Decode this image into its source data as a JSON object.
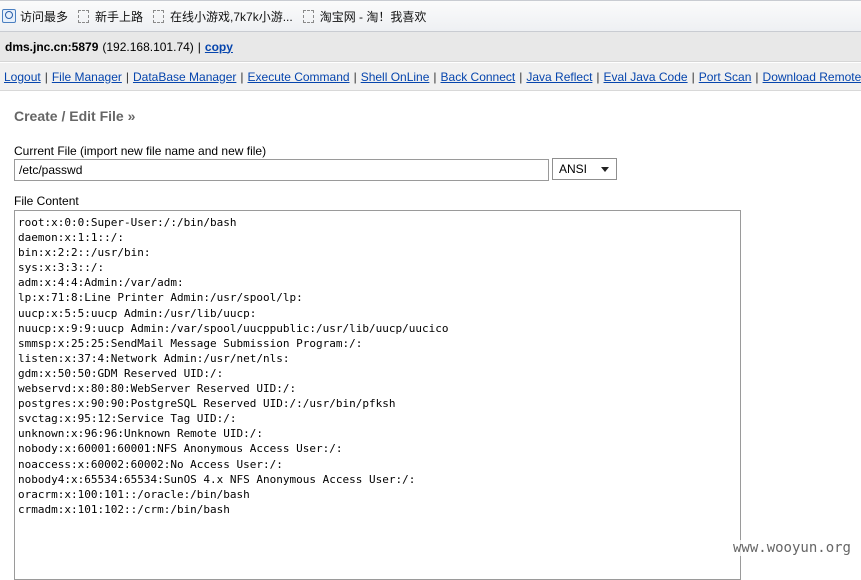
{
  "bookmarks": [
    {
      "icon": "search-icon",
      "label": "访问最多"
    },
    {
      "icon": "page-icon",
      "label": "新手上路"
    },
    {
      "icon": "page-icon",
      "label": "在线小游戏,7k7k小游..."
    },
    {
      "icon": "page-icon",
      "label": "淘宝网 - 淘！我喜欢"
    }
  ],
  "host": {
    "name": "dms.jnc.cn:5879",
    "ip": "(192.168.101.74)",
    "separator": "|",
    "copy_label": "copy"
  },
  "nav": [
    "Logout",
    "File Manager",
    "DataBase Manager",
    "Execute Command",
    "Shell OnLine",
    "Back Connect",
    "Java Reflect",
    "Eval Java Code",
    "Port Scan",
    "Download Remote"
  ],
  "form": {
    "title": "Create / Edit File »",
    "current_file_label": "Current File (import new file name and new file)",
    "current_file_value": "/etc/passwd",
    "encoding_selected": "ANSI",
    "content_label": "File Content",
    "content": "root:x:0:0:Super-User:/:/bin/bash\ndaemon:x:1:1::/:\nbin:x:2:2::/usr/bin:\nsys:x:3:3::/:\nadm:x:4:4:Admin:/var/adm:\nlp:x:71:8:Line Printer Admin:/usr/spool/lp:\nuucp:x:5:5:uucp Admin:/usr/lib/uucp:\nnuucp:x:9:9:uucp Admin:/var/spool/uucppublic:/usr/lib/uucp/uucico\nsmmsp:x:25:25:SendMail Message Submission Program:/:\nlisten:x:37:4:Network Admin:/usr/net/nls:\ngdm:x:50:50:GDM Reserved UID:/:\nwebservd:x:80:80:WebServer Reserved UID:/:\npostgres:x:90:90:PostgreSQL Reserved UID:/:/usr/bin/pfksh\nsvctag:x:95:12:Service Tag UID:/:\nunknown:x:96:96:Unknown Remote UID:/:\nnobody:x:60001:60001:NFS Anonymous Access User:/:\nnoaccess:x:60002:60002:No Access User:/:\nnobody4:x:65534:65534:SunOS 4.x NFS Anonymous Access User:/:\noracrm:x:100:101::/oracle:/bin/bash\ncrmadm:x:101:102::/crm:/bin/bash"
  },
  "watermark": "www.wooyun.org"
}
